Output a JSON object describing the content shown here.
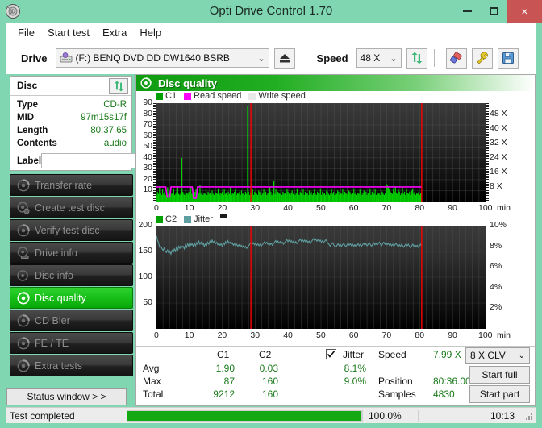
{
  "window": {
    "title": "Opti Drive Control 1.70",
    "app_icon": "disc-icon",
    "minimize": "minimize-icon",
    "maximize": "maximize-icon",
    "close": "×"
  },
  "menu": {
    "items": [
      "File",
      "Start test",
      "Extra",
      "Help"
    ]
  },
  "toolbar": {
    "drive_label": "Drive",
    "drive_value": "(F:)   BENQ DVD DD DW1640 BSRB",
    "eject_icon": "eject-icon",
    "speed_label": "Speed",
    "speed_value": "48 X",
    "refresh_icon": "refresh-icon",
    "eraser_icon": "eraser-icon",
    "tools_icon": "tools-icon",
    "save_icon": "save-icon"
  },
  "disc": {
    "header": "Disc",
    "refresh_icon": "refresh-icon",
    "rows": [
      {
        "key": "Type",
        "value": "CD-R"
      },
      {
        "key": "MID",
        "value": "97m15s17f"
      },
      {
        "key": "Length",
        "value": "80:37.65"
      },
      {
        "key": "Contents",
        "value": "audio"
      }
    ],
    "label_key": "Label",
    "label_value": "",
    "label_placeholder": "",
    "cd_icon": "cd-disc-icon"
  },
  "nav": {
    "items": [
      {
        "label": "Transfer rate",
        "icon": "disc-icon",
        "active": false
      },
      {
        "label": "Create test disc",
        "icon": "disc-write-icon",
        "active": false
      },
      {
        "label": "Verify test disc",
        "icon": "disc-icon",
        "active": false
      },
      {
        "label": "Drive info",
        "icon": "drive-icon",
        "active": false
      },
      {
        "label": "Disc info",
        "icon": "disc-info-icon",
        "active": false
      },
      {
        "label": "Disc quality",
        "icon": "disc-icon",
        "active": true
      },
      {
        "label": "CD Bler",
        "icon": "disc-icon",
        "active": false
      },
      {
        "label": "FE / TE",
        "icon": "disc-icon",
        "active": false
      },
      {
        "label": "Extra tests",
        "icon": "disc-icon",
        "active": false
      }
    ],
    "status_window_button": "Status window > >"
  },
  "panel": {
    "title": "Disc quality",
    "icon": "disc-icon"
  },
  "chart_data": [
    {
      "type": "line",
      "name": "c1-read-speed-chart",
      "title": "",
      "xlabel": "min",
      "ylabel": "",
      "xlim": [
        0,
        100
      ],
      "ylim": [
        0,
        90
      ],
      "grid": true,
      "legend": [
        {
          "label": "C1",
          "color": "#00a000"
        },
        {
          "label": "Read speed",
          "color": "#ff00ff"
        },
        {
          "label": "Write speed",
          "color": "#e8e8e8"
        }
      ],
      "x_ticks": [
        "0",
        "10",
        "20",
        "30",
        "40",
        "50",
        "60",
        "70",
        "80",
        "90",
        "100"
      ],
      "x_tick_values": [
        0,
        10,
        20,
        30,
        40,
        50,
        60,
        70,
        80,
        90,
        100
      ],
      "x_unit": "min",
      "y_ticks": [
        "10",
        "20",
        "30",
        "40",
        "50",
        "60",
        "70",
        "80",
        "90"
      ],
      "y_tick_values": [
        10,
        20,
        30,
        40,
        50,
        60,
        70,
        80,
        90
      ],
      "y2_ticks": [
        "8 X",
        "16 X",
        "24 X",
        "32 X",
        "40 X",
        "48 X"
      ],
      "y2_tick_values": [
        8,
        16,
        24,
        32,
        40,
        48
      ],
      "y2_lim": [
        0,
        54
      ],
      "markers": [
        {
          "x": 28.7,
          "color": "#ff0000",
          "label": "position-marker"
        },
        {
          "x": 80.6,
          "color": "#ff0000",
          "label": "end-marker"
        }
      ],
      "series": [
        {
          "name": "C1",
          "color": "#00d000",
          "style": "spikes",
          "x_start": 0,
          "x_end": 80.6,
          "values": [
            6,
            9,
            7,
            13,
            8,
            6,
            11,
            7,
            9,
            6,
            8,
            13,
            7,
            6,
            9,
            7,
            8,
            12,
            6,
            7,
            9,
            14,
            7,
            6,
            8,
            40,
            9,
            7,
            6,
            11,
            8,
            7,
            9,
            6,
            13,
            7,
            8,
            6,
            9,
            11,
            7,
            6,
            8,
            15,
            7,
            9,
            6,
            8,
            7,
            11,
            6,
            9,
            7,
            8,
            6,
            10,
            7,
            6,
            9,
            8,
            7,
            12,
            6,
            8,
            7,
            9,
            6,
            11,
            7,
            8,
            6,
            9,
            7,
            13,
            6,
            8,
            7,
            9,
            11,
            6,
            8,
            7,
            9,
            6,
            10,
            7,
            8,
            6,
            9,
            7,
            87,
            9,
            6,
            8,
            7,
            11,
            6,
            9,
            8,
            7,
            6,
            10,
            9,
            7,
            6,
            8,
            11,
            7,
            9,
            6,
            8,
            7,
            13,
            9,
            6,
            8,
            19,
            7,
            11,
            6,
            9,
            8,
            7,
            12,
            6,
            9,
            7,
            8,
            6,
            11,
            9,
            7,
            6,
            8,
            10,
            7,
            9,
            6,
            8,
            12,
            7,
            6,
            9,
            8,
            7,
            11,
            6,
            9,
            7,
            8,
            6,
            10,
            7,
            9,
            6,
            8,
            11,
            7,
            6,
            9,
            8,
            7,
            12,
            6,
            9,
            7,
            8,
            6,
            10,
            9,
            7,
            6,
            8,
            11,
            7,
            9,
            6,
            8,
            7,
            10,
            9,
            6,
            8,
            7,
            11,
            6,
            9,
            8,
            7,
            6,
            10,
            9,
            7,
            6,
            8,
            12,
            7,
            9,
            6,
            8,
            7,
            11,
            9,
            6,
            8,
            10,
            7,
            9,
            6,
            8,
            7,
            12,
            6,
            9,
            8,
            7,
            11,
            6,
            9,
            7,
            8,
            6,
            10,
            9,
            7,
            6,
            8,
            16,
            15,
            13,
            11,
            9,
            8,
            7,
            12,
            9,
            14,
            8,
            7,
            11,
            9,
            6,
            8,
            13,
            7,
            9,
            6,
            11,
            8,
            7,
            9,
            6,
            10,
            12,
            7,
            9,
            6,
            8,
            7,
            9,
            6,
            8,
            7
          ]
        },
        {
          "name": "Read speed",
          "color": "#ff00ff",
          "style": "line",
          "constant": 13.3,
          "x_start": 0,
          "x_end": 80.6,
          "note": "flat 8X CLV read speed trace with brief dips near 3.5 and 11.5 min"
        }
      ]
    },
    {
      "type": "line",
      "name": "c2-jitter-chart",
      "title": "",
      "xlabel": "min",
      "ylabel": "",
      "xlim": [
        0,
        100
      ],
      "ylim": [
        0,
        200
      ],
      "grid": true,
      "legend": [
        {
          "label": "C2",
          "color": "#00a000"
        },
        {
          "label": "Jitter",
          "color": "#5f9ea0"
        }
      ],
      "x_ticks": [
        "0",
        "10",
        "20",
        "30",
        "40",
        "50",
        "60",
        "70",
        "80",
        "90",
        "100"
      ],
      "x_tick_values": [
        0,
        10,
        20,
        30,
        40,
        50,
        60,
        70,
        80,
        90,
        100
      ],
      "x_unit": "min",
      "y_ticks": [
        "50",
        "100",
        "150",
        "200"
      ],
      "y_tick_values": [
        50,
        100,
        150,
        200
      ],
      "y2_ticks": [
        "2%",
        "4%",
        "6%",
        "8%",
        "10%"
      ],
      "y2_tick_values": [
        2,
        4,
        6,
        8,
        10
      ],
      "y2_lim": [
        0,
        10
      ],
      "markers": [
        {
          "x": 28.7,
          "color": "#ff0000",
          "label": "position-marker"
        },
        {
          "x": 80.6,
          "color": "#ff0000",
          "label": "end-marker"
        }
      ],
      "series": [
        {
          "name": "Jitter",
          "color": "#5f9ea0",
          "style": "line",
          "x_start": 0,
          "x_end": 80.6,
          "values": [
            180,
            172,
            165,
            158,
            160,
            155,
            152,
            157,
            150,
            148,
            153,
            147,
            150,
            145,
            152,
            148,
            155,
            150,
            158,
            152,
            160,
            156,
            162,
            158,
            160,
            155,
            163,
            158,
            165,
            160,
            168,
            162,
            165,
            160,
            166,
            161,
            167,
            163,
            170,
            164,
            168,
            162,
            166,
            160,
            165,
            162,
            168,
            164,
            170,
            166,
            172,
            167,
            170,
            165,
            168,
            163,
            166,
            162,
            165,
            160,
            167,
            163,
            169,
            165,
            171,
            166,
            168,
            164,
            167,
            162,
            165,
            161,
            164,
            160,
            163,
            159,
            162,
            158,
            161,
            157,
            160,
            156,
            159,
            162,
            165,
            168,
            164,
            167,
            163,
            166,
            162,
            165,
            161,
            164,
            160,
            163,
            166,
            169,
            165,
            168,
            164,
            167,
            163,
            166,
            162,
            165,
            168,
            171,
            167,
            170,
            166,
            169,
            165,
            168,
            164,
            167,
            170,
            173,
            169,
            172,
            168,
            171,
            167,
            170,
            166,
            169,
            165,
            168,
            171,
            174,
            170,
            173,
            169,
            172,
            168,
            171,
            167,
            170,
            166,
            169,
            172,
            175,
            171,
            174,
            170,
            173,
            169,
            172,
            168,
            171,
            167,
            170,
            173,
            169,
            166,
            163,
            160,
            164,
            167,
            163,
            160,
            158,
            162,
            165,
            161,
            164,
            160,
            163,
            166,
            162,
            159,
            163,
            166,
            162,
            165,
            161,
            164,
            160,
            163,
            159,
            162,
            165,
            161,
            164,
            160,
            163,
            166,
            162,
            165,
            161,
            164,
            167,
            163,
            160,
            164,
            167,
            163,
            166,
            162,
            165,
            168,
            164,
            161,
            165,
            168,
            164,
            167,
            163,
            166,
            162,
            165,
            161,
            164,
            160,
            163,
            166,
            162,
            159,
            163,
            160,
            164,
            161,
            158,
            162,
            165,
            161,
            164,
            160,
            157,
            161,
            164,
            160,
            163,
            159,
            162,
            158,
            161,
            164,
            160
          ]
        }
      ]
    }
  ],
  "results": {
    "col_c1": "C1",
    "col_c2": "C2",
    "jitter_label": "Jitter",
    "jitter_checked": true,
    "rows": [
      {
        "name": "Avg",
        "c1": "1.90",
        "c2": "0.03",
        "jitter": "8.1%"
      },
      {
        "name": "Max",
        "c1": "87",
        "c2": "160",
        "jitter": "9.0%"
      },
      {
        "name": "Total",
        "c1": "9212",
        "c2": "160",
        "jitter": ""
      }
    ],
    "speed_label": "Speed",
    "speed_value": "7.99 X",
    "position_label": "Position",
    "position_value": "80:36.00",
    "samples_label": "Samples",
    "samples_value": "4830",
    "mode_value": "8 X CLV",
    "start_full": "Start full",
    "start_part": "Start part"
  },
  "status": {
    "text": "Test completed",
    "progress_pct": 100.0,
    "progress_label": "100.0%",
    "elapsed": "10:13"
  },
  "colors": {
    "accent_green": "#0f9b0f",
    "chrome": "#7fd6b0",
    "close_red": "#c85454",
    "value_green": "#1a7a1a",
    "c1_green": "#00d000",
    "read_magenta": "#ff00ff",
    "jitter_teal": "#5f9ea0",
    "marker_red": "#ff0000"
  }
}
